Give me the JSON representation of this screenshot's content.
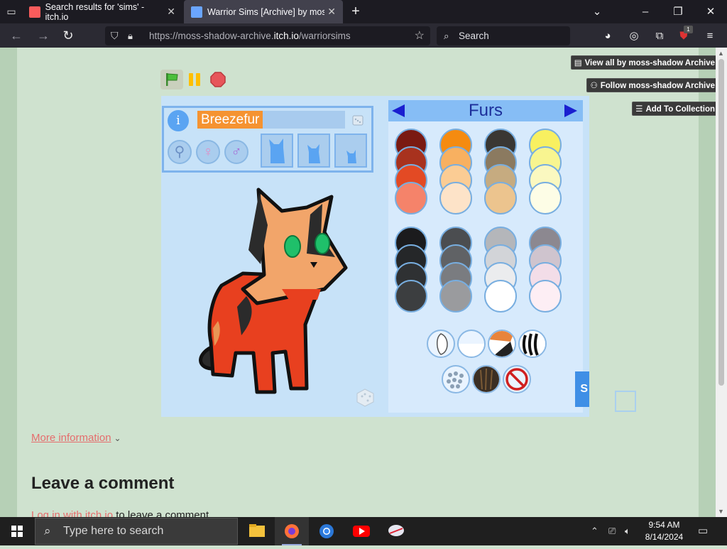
{
  "browser": {
    "tabs": [
      {
        "title": "Search results for 'sims' - itch.io"
      },
      {
        "title": "Warrior Sims [Archive] by moss-shadow Archive"
      }
    ],
    "url_prefix": "https://moss-shadow-archive.",
    "url_domain": "itch.io",
    "url_path": "/warriorsims",
    "search_placeholder": "Search",
    "extension_badge": "1"
  },
  "itch_buttons": {
    "view_all": "View all by moss-shadow Archive",
    "follow": "Follow moss-shadow Archive",
    "add_collection": "Add To Collection"
  },
  "game": {
    "cat_name": "Breezefur",
    "fur_section_title": "Furs",
    "info_label": "i",
    "fur_colors": [
      [
        "#7a1a12",
        "#a8321e",
        "#e34a24",
        "#f5836a"
      ],
      [
        "#f58b10",
        "#f8b060",
        "#fbcc94",
        "#fde3c8"
      ],
      [
        "#3a3733",
        "#8b7a60",
        "#c6ab80",
        "#ecc48e"
      ],
      [
        "#f8f060",
        "#f8f590",
        "#faf8c0",
        "#fdfde6"
      ],
      [
        "#1b1b1d",
        "#252729",
        "#2f3133",
        "#3c3e40"
      ],
      [
        "#4b4d50",
        "#606265",
        "#7a7c80",
        "#9a9b9e"
      ],
      [
        "#b4b6ba",
        "#d2d4d8",
        "#ebecee",
        "#ffffff"
      ],
      [
        "#8c8890",
        "#cfc4ce",
        "#f3dde8",
        "#fdeef4"
      ]
    ],
    "blue_tab_label": "S"
  },
  "page": {
    "more_information": "More information",
    "leave_comment": "Leave a comment",
    "login_link": "Log in with itch.io",
    "login_suffix": " to leave a comment."
  },
  "taskbar": {
    "search_placeholder": "Type here to search",
    "time": "9:54 AM",
    "date": "8/14/2024"
  }
}
